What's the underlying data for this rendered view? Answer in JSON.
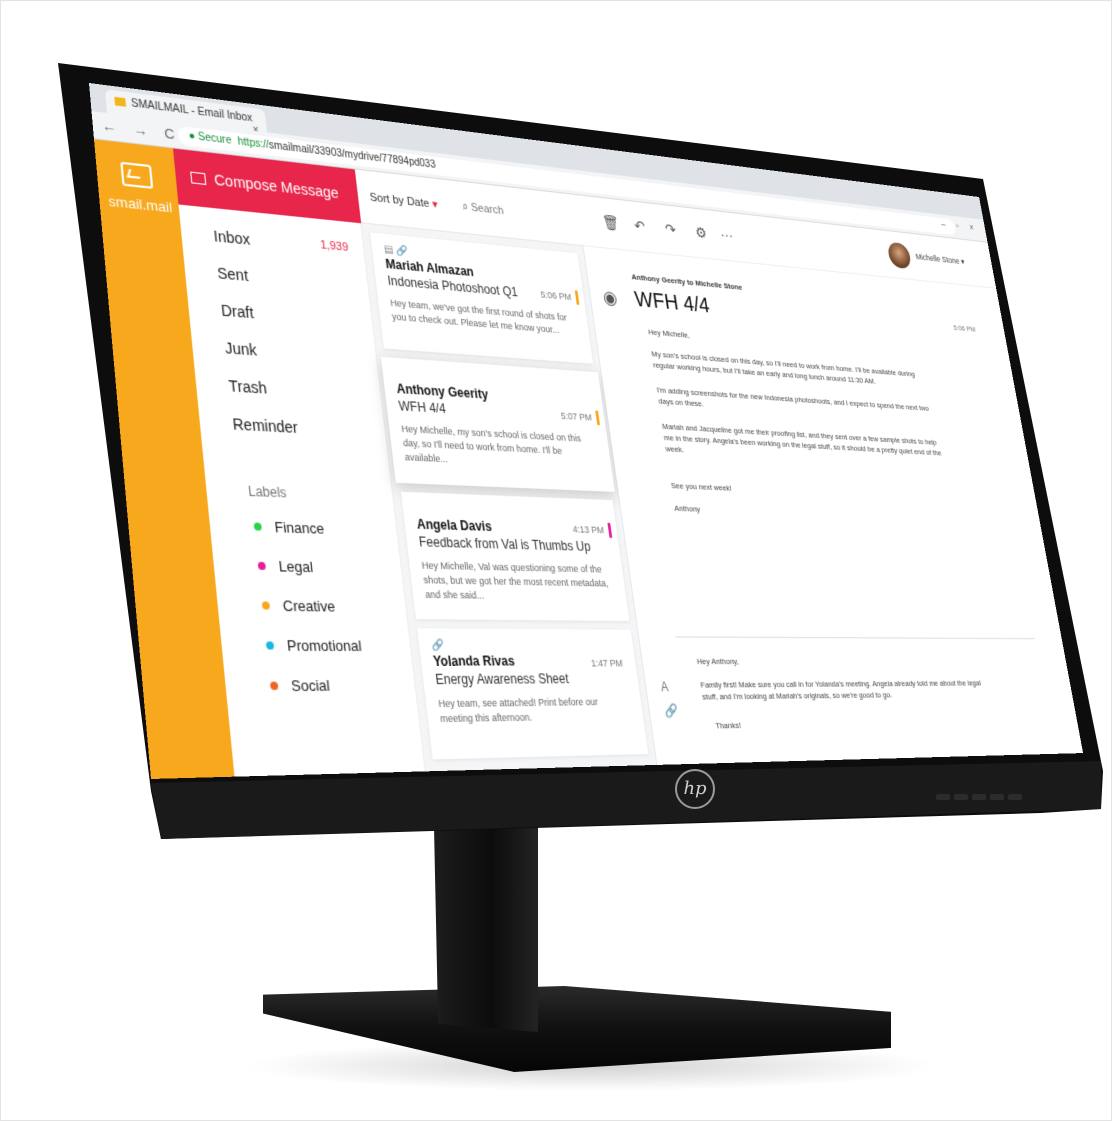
{
  "browser": {
    "tab_title": "SMAILMAIL - Email Inbox",
    "tab_close": "×",
    "nav_icons": "← → C",
    "secure_label": "Secure",
    "url_https": "https://",
    "url_rest": "smailmail/33903/mydrive/77894pd033",
    "window_controls": "– ▫ ×"
  },
  "app": {
    "logo_text": "smail.mail",
    "compose_label": "Compose Message",
    "folders": [
      {
        "label": "Inbox",
        "count": "1,939"
      },
      {
        "label": "Sent",
        "count": ""
      },
      {
        "label": "Draft",
        "count": ""
      },
      {
        "label": "Junk",
        "count": ""
      },
      {
        "label": "Trash",
        "count": ""
      },
      {
        "label": "Reminder",
        "count": ""
      }
    ],
    "labels_title": "Labels",
    "labels": [
      {
        "label": "Finance",
        "color": "#2bd14a"
      },
      {
        "label": "Legal",
        "color": "#e81d9c"
      },
      {
        "label": "Creative",
        "color": "#f7a81d"
      },
      {
        "label": "Promotional",
        "color": "#19b6e6"
      },
      {
        "label": "Social",
        "color": "#f06322"
      }
    ]
  },
  "list": {
    "sort_label": "Sort by Date",
    "sort_caret": "▾",
    "search_placeholder": "Search",
    "emails": [
      {
        "icons": "▤ 🔗",
        "sender": "Mariah Almazan",
        "subject": "Indonesia Photoshoot Q1",
        "time": "5:06 PM",
        "flag": "#f7a81d",
        "preview": "Hey team, we've got the first round of shots for you to check out. Please let me know your..."
      },
      {
        "icons": "",
        "sender": "Anthony Geerity",
        "subject": "WFH 4/4",
        "time": "5:07 PM",
        "flag": "#f7a81d",
        "preview": "Hey Michelle, my son's school is closed on this day, so I'll need to work from home. I'll be available..."
      },
      {
        "icons": "",
        "sender": "Angela Davis",
        "subject": "Feedback from Val is Thumbs Up",
        "time": "4:13 PM",
        "flag": "#e81d9c",
        "preview": "Hey Michelle, Val was questioning some of the shots, but we got her the most recent metadata, and she said..."
      },
      {
        "icons": "🔗",
        "sender": "Yolanda Rivas",
        "subject": "Energy Awareness Sheet",
        "time": "1:47 PM",
        "flag": "",
        "preview": "Hey team, see attached! Print before our meeting this afternoon."
      }
    ]
  },
  "reader": {
    "tools": [
      "🗑",
      "↶",
      "↷",
      "⚙",
      "···"
    ],
    "user_name": "Michelle Stone ▾",
    "from_to": "Anthony Geerity to Michelle Stone",
    "title": "WFH 4/4",
    "time": "5:06 PM",
    "body": [
      "Hey Michelle,",
      "My son's school is closed on this day, so I'll need to work from home. I'll be available during regular working hours, but I'll take an early and long lunch around 11:30 AM.",
      "I'm adding screenshots for the new Indonesia photoshoots, and I expect to spend the next two days on these.",
      "Mariah and Jacqueline got me their proofing list, and they sent over a few sample shots to help me in the story. Angela's been working on the legal stuff, so it should be a pretty quiet end of the week.",
      "See you next week!",
      "Anthony"
    ],
    "reply": [
      "Hey Anthony,",
      "Family first! Make sure you call in for Yolanda's meeting. Angela already told me about the legal stuff, and I'm looking at Mariah's originals, so we're good to go.",
      "Thanks!"
    ]
  },
  "monitor": {
    "brand": "hp"
  }
}
